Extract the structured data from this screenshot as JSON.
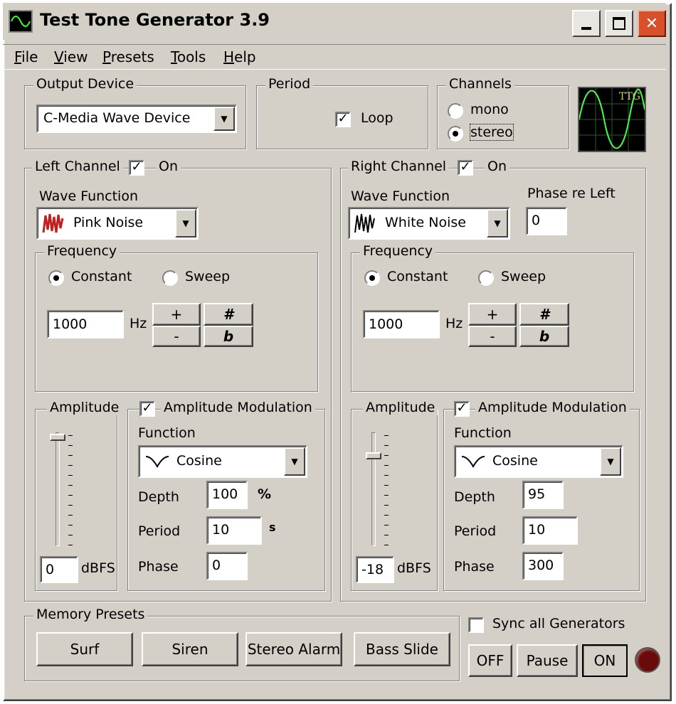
{
  "window": {
    "title": "Test Tone Generator 3.9",
    "controls": [
      "minimize-icon",
      "maximize-icon",
      "close-icon"
    ]
  },
  "menu": [
    "File",
    "View",
    "Presets",
    "Tools",
    "Help"
  ],
  "output_device": {
    "label": "Output Device",
    "value": "C-Media Wave Device"
  },
  "period": {
    "label": "Period",
    "loop_label": "Loop",
    "loop_checked": true
  },
  "channels": {
    "label": "Channels",
    "mono": "mono",
    "stereo": "stereo",
    "selected": "stereo"
  },
  "logo": {
    "text": "TTG"
  },
  "left": {
    "title": "Left Channel",
    "on_label": "On",
    "on": true,
    "wave_label": "Wave Function",
    "wave": "Pink Noise",
    "freq_label": "Frequency",
    "constant": "Constant",
    "sweep": "Sweep",
    "mode": "constant",
    "freq_value": "1000",
    "hz": "Hz",
    "plus": "+",
    "minus": "-",
    "sharp": "#",
    "flat": "b",
    "amp_label": "Amplitude",
    "amp_value": "0",
    "dbfs": "dBFS",
    "amp_level": 0.04,
    "am_label": "Amplitude Modulation",
    "am_on": true,
    "function_label": "Function",
    "function": "Cosine",
    "depth_label": "Depth",
    "depth": "100",
    "depth_unit": "%",
    "period_label": "Period",
    "period": "10",
    "period_unit": "s",
    "phase_label": "Phase",
    "phase": "0"
  },
  "right": {
    "title": "Right Channel",
    "on_label": "On",
    "on": true,
    "wave_label": "Wave Function",
    "wave": "White Noise",
    "phase_re_left_label": "Phase re Left",
    "phase_re_left": "0",
    "freq_label": "Frequency",
    "constant": "Constant",
    "sweep": "Sweep",
    "mode": "constant",
    "freq_value": "1000",
    "hz": "Hz",
    "plus": "+",
    "minus": "-",
    "sharp": "#",
    "flat": "b",
    "amp_label": "Amplitude",
    "amp_value": "-18",
    "dbfs": "dBFS",
    "amp_level": 0.2,
    "am_label": "Amplitude Modulation",
    "am_on": true,
    "function_label": "Function",
    "function": "Cosine",
    "depth_label": "Depth",
    "depth": "95",
    "period_label": "Period",
    "period": "10",
    "phase_label": "Phase",
    "phase": "300"
  },
  "presets": {
    "label": "Memory Presets",
    "buttons": [
      "Surf",
      "Siren",
      "Stereo Alarm",
      "Bass Slide"
    ]
  },
  "sync": {
    "label": "Sync all Generators",
    "checked": false
  },
  "transport": {
    "off": "OFF",
    "pause": "Pause",
    "on": "ON",
    "indicator_color": "#6a0a0a"
  }
}
